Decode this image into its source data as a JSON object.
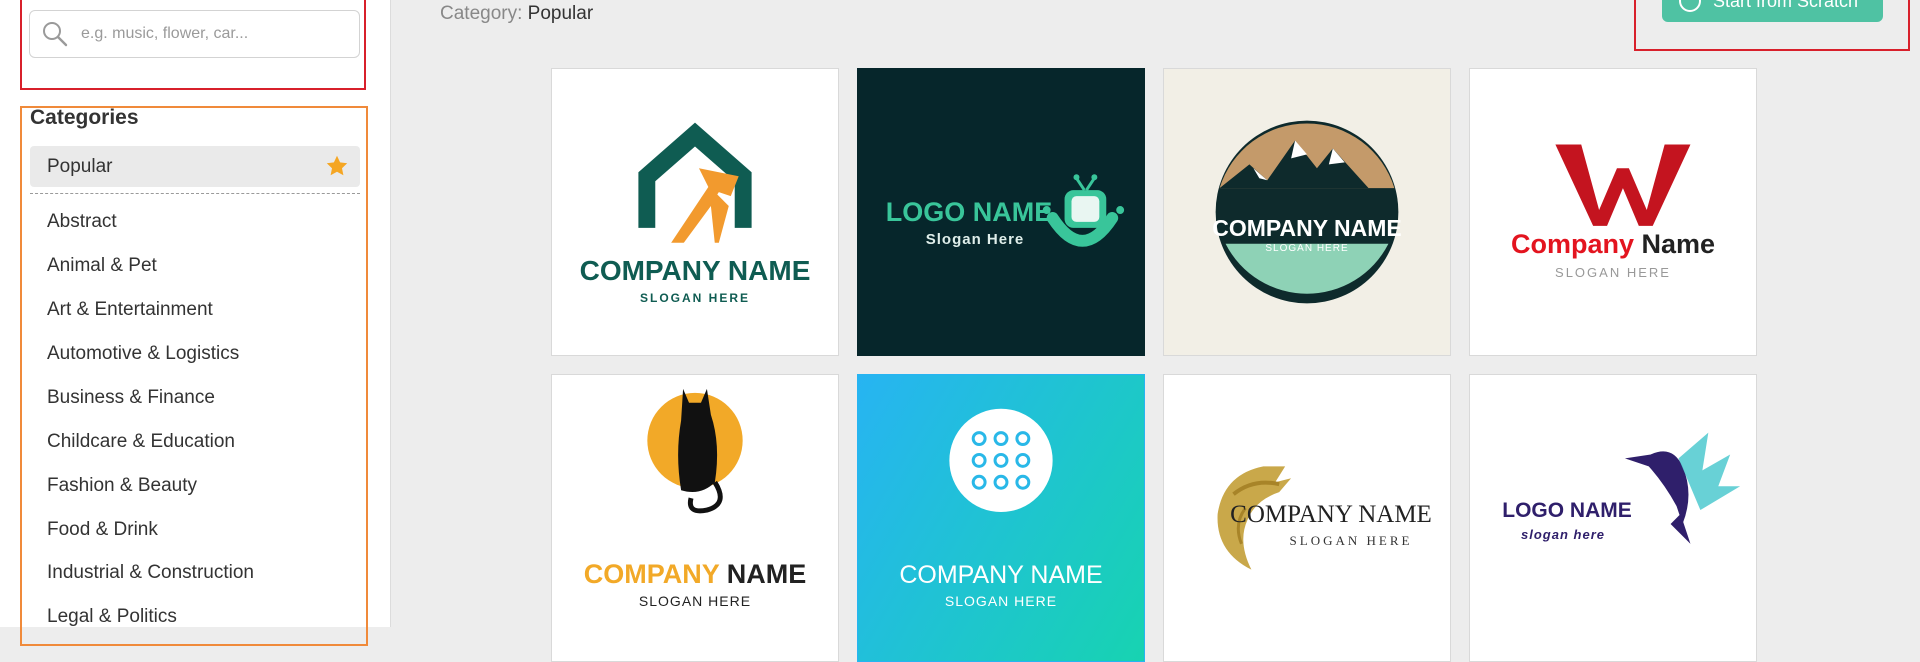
{
  "search": {
    "placeholder": "e.g. music, flower, car...",
    "value": ""
  },
  "sidebar": {
    "title": "Categories",
    "popular_label": "Popular",
    "items": [
      "Abstract",
      "Animal & Pet",
      "Art & Entertainment",
      "Automotive & Logistics",
      "Business & Finance",
      "Childcare & Education",
      "Fashion & Beauty",
      "Food & Drink",
      "Industrial & Construction",
      "Legal & Politics"
    ]
  },
  "header": {
    "category_prefix": "Category:",
    "category_value": "Popular",
    "start_button": "Start from Scratch"
  },
  "logos": [
    {
      "name": "COMPANY NAME",
      "slogan": "SLOGAN HERE"
    },
    {
      "name": "LOGO NAME",
      "slogan": "Slogan Here"
    },
    {
      "name": "COMPANY NAME",
      "slogan": "SLOGAN HERE"
    },
    {
      "name_a": "Company",
      "name_b": "Name",
      "slogan": "SLOGAN HERE"
    },
    {
      "name_a": "COMPANY",
      "name_b": "NAME",
      "slogan": "SLOGAN HERE"
    },
    {
      "name": "COMPANY NAME",
      "slogan": "SLOGAN HERE"
    },
    {
      "name": "COMPANY NAME",
      "slogan": "SLOGAN HERE"
    },
    {
      "name": "LOGO NAME",
      "slogan": "slogan here"
    }
  ],
  "colors": {
    "accent_green": "#4fc2a3",
    "highlight_red": "#d8202b",
    "highlight_orange": "#f08a3a",
    "star": "#f5a623"
  },
  "icons": {
    "search": "search-icon",
    "star": "star-icon",
    "plus": "plus-circle-icon"
  }
}
